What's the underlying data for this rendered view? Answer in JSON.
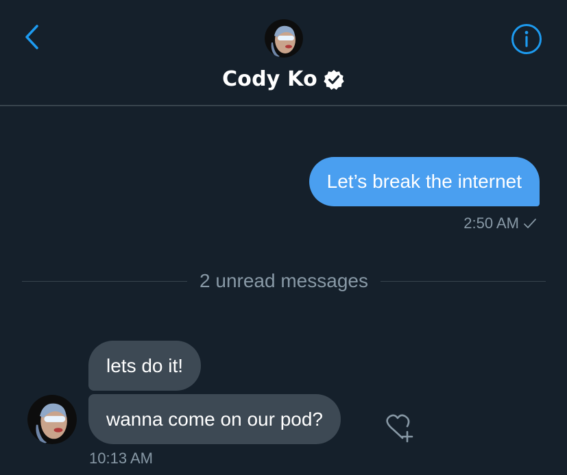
{
  "header": {
    "contact_name": "Cody Ko",
    "back_icon": "chevron-left-icon",
    "info_icon": "info-icon",
    "verified_icon": "verified-badge-icon",
    "accent_color": "#1d9bf0"
  },
  "messages": {
    "outgoing": [
      {
        "text": "Let’s break the internet",
        "time": "2:50 AM",
        "status_icon": "checkmark-icon"
      }
    ],
    "unread_divider": "2 unread messages",
    "incoming": [
      {
        "text": "lets do it!"
      },
      {
        "text": "wanna come on our pod?"
      }
    ],
    "incoming_time": "10:13 AM",
    "like_icon": "heart-plus-icon"
  },
  "colors": {
    "background": "#15202b",
    "outgoing_bubble": "#4a9ff0",
    "incoming_bubble": "#3d4954",
    "muted_text": "#8899a6",
    "divider": "#38444d"
  }
}
